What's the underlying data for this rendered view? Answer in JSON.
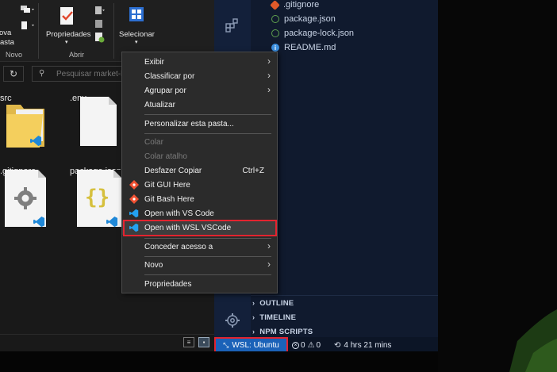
{
  "explorer": {
    "ribbon": {
      "nova_pasta": [
        "ova",
        "asta"
      ],
      "propriedades": "Propriedades",
      "selecionar": "Selecionar",
      "group_novo": "Novo",
      "group_abrir": "Abrir"
    },
    "search": {
      "placeholder": "Pesquisar market-l"
    },
    "files": [
      {
        "name": "src"
      },
      {
        "name": ".env"
      },
      {
        "name": ".gitignore"
      },
      {
        "name": "package.json"
      }
    ]
  },
  "context_menu": {
    "items": [
      {
        "label": "Exibir",
        "submenu": true
      },
      {
        "label": "Classificar por",
        "submenu": true
      },
      {
        "label": "Agrupar por",
        "submenu": true
      },
      {
        "label": "Atualizar"
      },
      {
        "label": "Personalizar esta pasta..."
      },
      {
        "label": "Colar",
        "disabled": true
      },
      {
        "label": "Colar atalho",
        "disabled": true
      },
      {
        "label": "Desfazer Copiar",
        "shortcut": "Ctrl+Z"
      },
      {
        "label": "Git GUI Here"
      },
      {
        "label": "Git Bash Here"
      },
      {
        "label": "Open with VS Code"
      },
      {
        "label": "Open with WSL VSCode",
        "highlighted": true
      },
      {
        "label": "Conceder acesso a",
        "submenu": true
      },
      {
        "label": "Novo",
        "submenu": true
      },
      {
        "label": "Propriedades"
      }
    ]
  },
  "vscode": {
    "tree": [
      {
        "name": ".gitignore",
        "icon": "git-icon"
      },
      {
        "name": "package.json",
        "icon": "node-icon"
      },
      {
        "name": "package-lock.json",
        "icon": "node-icon"
      },
      {
        "name": "README.md",
        "icon": "info-icon"
      }
    ],
    "sections": [
      "OUTLINE",
      "TIMELINE",
      "NPM SCRIPTS"
    ],
    "status": {
      "remote": "WSL: Ubuntu",
      "errors": "0",
      "warnings": "0",
      "time": "4 hrs 21 mins"
    }
  },
  "colors": {
    "highlight_border": "#e3232f",
    "remote_bg": "#1b62b8",
    "vscode_bg": "#0f1a2b",
    "menu_bg": "#2b2b2b"
  }
}
